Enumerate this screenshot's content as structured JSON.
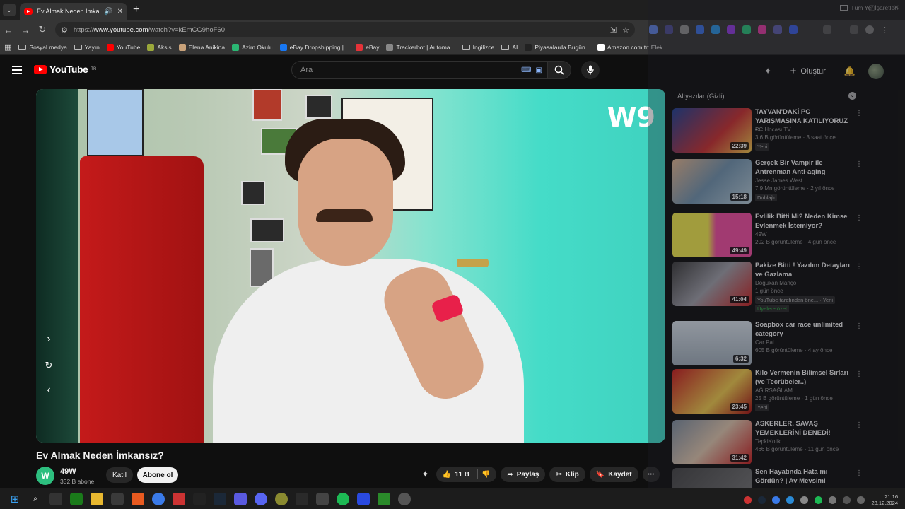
{
  "browser": {
    "tab_title": "Ev Almak Neden İmkansız?",
    "url_prefix": "https://",
    "url_host": "www.youtube.com",
    "url_path": "/watch?v=kEmCG9hoF60",
    "bookmarks": [
      {
        "label": "Sosyal medya",
        "kind": "folder"
      },
      {
        "label": "Yayın",
        "kind": "folder"
      },
      {
        "label": "YouTube",
        "kind": "site",
        "color": "#ff0000"
      },
      {
        "label": "Aksis",
        "kind": "site",
        "color": "#9aa83a"
      },
      {
        "label": "Elena Anikina",
        "kind": "site",
        "color": "#c9a27a"
      },
      {
        "label": "Azim Okulu",
        "kind": "site",
        "color": "#2bb673"
      },
      {
        "label": "eBay Dropshipping |...",
        "kind": "site",
        "color": "#1877f2"
      },
      {
        "label": "eBay",
        "kind": "site",
        "color": "#e53238"
      },
      {
        "label": "Trackerbot | Automa...",
        "kind": "site",
        "color": "#888888"
      },
      {
        "label": "İngilizce",
        "kind": "folder"
      },
      {
        "label": "AI",
        "kind": "folder"
      },
      {
        "label": "Piyasalarda Bugün...",
        "kind": "site",
        "color": "#222222"
      },
      {
        "label": "Amazon.com.tr: Elek...",
        "kind": "site",
        "color": "#ffffff"
      }
    ],
    "bookmarks_right": "Tüm Yer İşaretleri"
  },
  "youtube": {
    "logo_text": "YouTube",
    "logo_region": "TR",
    "search_placeholder": "Ara",
    "create_label": "Oluştur"
  },
  "video": {
    "title": "Ev Almak Neden İmkansız?",
    "channel_name": "49W",
    "channel_initial": "W",
    "subscribers": "332 B abone",
    "join_label": "Katıl",
    "subscribe_label": "Abone ol",
    "likes": "11 B",
    "share_label": "Paylaş",
    "clip_label": "Klip",
    "save_label": "Kaydet",
    "watermark": "W9"
  },
  "sidebar": {
    "header": "Altyazılar (Gizli)",
    "items": [
      {
        "title": "TAYVAN'DAKİ PC YARIŞMASINA KATILIYORUZ -...",
        "channel": "PC Hocası TV",
        "meta": "3,6 B görüntüleme · 3 saat önce",
        "tag": "Yeni",
        "duration": "22:39",
        "thumb": "linear-gradient(135deg,#1f3f8f,#c22f2f 60%,#e8c04a)"
      },
      {
        "title": "Gerçek Bir Vampir ile Antrenman Anti-aging",
        "channel": "Jesse James West",
        "meta": "7,9 Mn görüntüleme · 2 yıl önce",
        "tag": "Dublajlı",
        "duration": "15:18",
        "thumb": "linear-gradient(135deg,#d9b08c,#6e8fa8 50%,#b0c4cf)"
      },
      {
        "title": "Evlilik Bitti Mi? Neden Kimse Evlenmek İstemiyor?",
        "channel": "49W",
        "meta": "202 B görüntüleme · 4 gün önce",
        "tag": "",
        "duration": "49:49",
        "thumb": "linear-gradient(90deg,#e8e04a 0%,#e8e04a 45%,#e84a9a 55%,#e84a9a 100%)"
      },
      {
        "title": "Pakize Bitti ! Yazılım Detayları ve Gazlama",
        "channel": "Doğukan Manço",
        "meta": "1 gün önce",
        "tag": "YouTube tarafından öne... · Yeni",
        "tag2": "Üyelere özel",
        "duration": "41:04",
        "thumb": "linear-gradient(135deg,#3a3a3a,#9a9aa2 50%,#c22020)"
      },
      {
        "title": "Soapbox car race unlimited category",
        "channel": "Car Pal",
        "meta": "605 B görüntüleme · 4 ay önce",
        "tag": "",
        "duration": "6:32",
        "thumb": "linear-gradient(180deg,#cfd8e0,#9aa7b2)"
      },
      {
        "title": "Kilo Vermenin Bilimsel Sırları (ve Tecrübeler..)",
        "channel": "AĞIRSAĞLAM",
        "meta": "25 B görüntüleme · 1 gün önce",
        "tag": "Yeni",
        "duration": "23:45",
        "thumb": "linear-gradient(135deg,#c21d1d,#e8c44a 60%,#a01010)"
      },
      {
        "title": "ASKERLER, SAVAŞ YEMEKLERİNİ DENEDİ!",
        "channel": "TepkiKolik",
        "meta": "466 B görüntüleme · 11 gün önce",
        "tag": "",
        "duration": "31:42",
        "thumb": "linear-gradient(135deg,#7b8a9a,#d8c0a8 50%,#c21d1d)"
      },
      {
        "title": "Sen Hayatında Hata mı Gördün? | Av Mevsimi",
        "channel": "",
        "meta": "",
        "tag": "",
        "duration": "",
        "thumb": "linear-gradient(135deg,#444,#777)"
      }
    ]
  },
  "taskbar": {
    "clock_time": "21:16",
    "clock_date": "28.12.2024"
  }
}
